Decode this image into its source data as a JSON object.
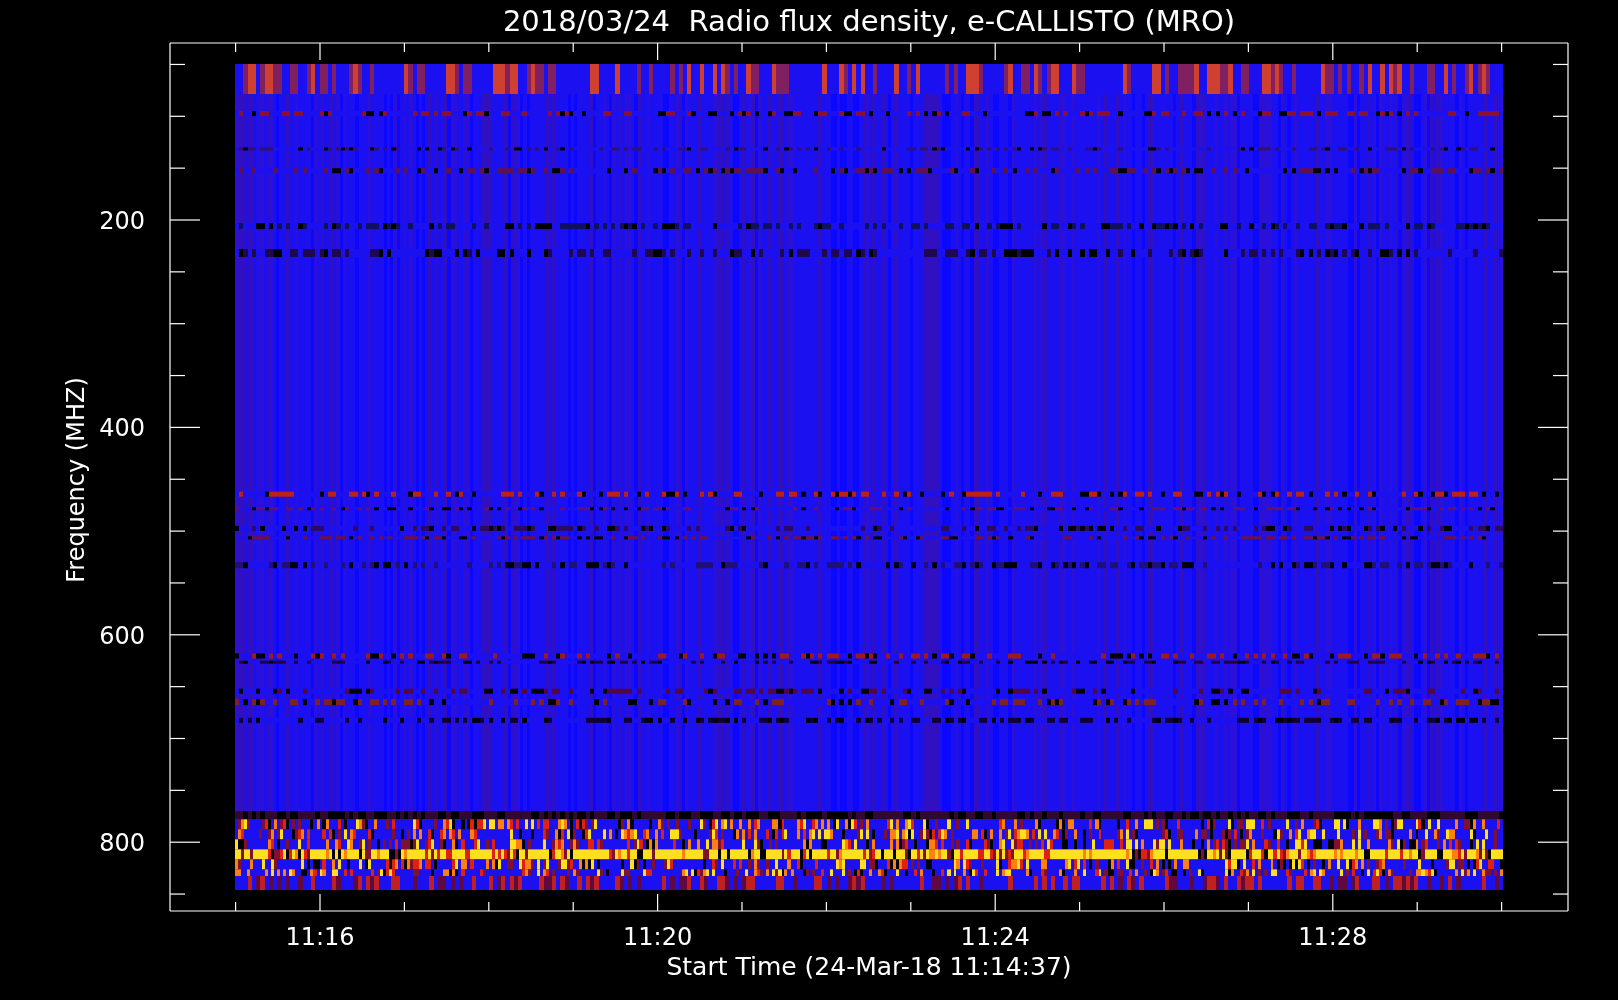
{
  "chart": {
    "title": "2018/03/24  Radio flux density, e-CALLISTO (MRO)",
    "ylabel": "Frequency (MHZ)",
    "xlabel": "Start Time (24-Mar-18 11:14:37)",
    "yticks": [
      "200",
      "400",
      "600",
      "800"
    ],
    "xticks": [
      "11:16",
      "11:20",
      "11:24",
      "11:28"
    ]
  }
}
